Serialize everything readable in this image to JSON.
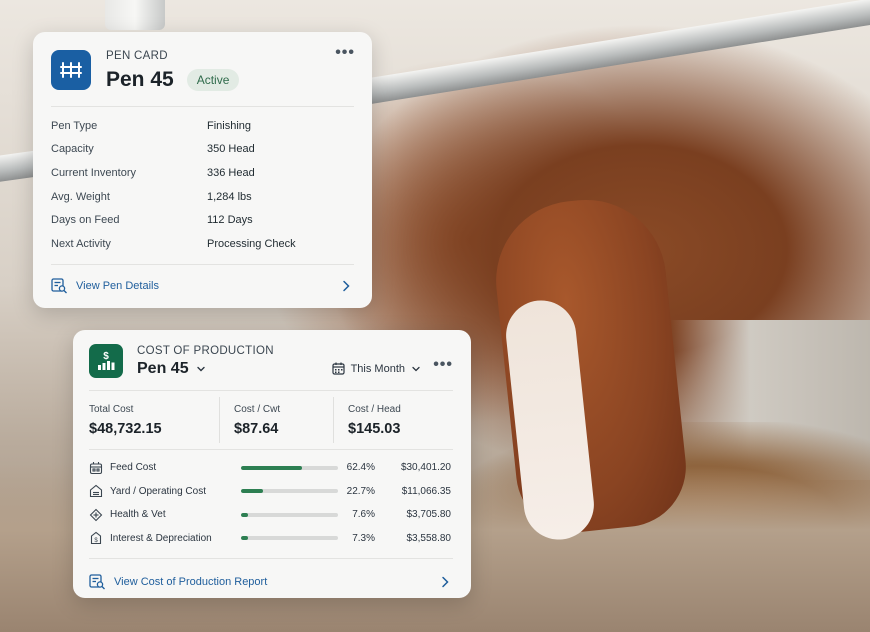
{
  "pen_card": {
    "eyebrow": "PEN CARD",
    "title": "Pen 45",
    "status": "Active",
    "rows": [
      {
        "label": "Pen Type",
        "value": "Finishing"
      },
      {
        "label": "Capacity",
        "value": "350 Head"
      },
      {
        "label": "Current Inventory",
        "value": "336 Head"
      },
      {
        "label": "Avg. Weight",
        "value": "1,284 lbs"
      },
      {
        "label": "Days on Feed",
        "value": "112 Days"
      },
      {
        "label": "Next Activity",
        "value": "Processing Check"
      }
    ],
    "link": "View Pen Details"
  },
  "cost_card": {
    "eyebrow": "COST OF PRODUCTION",
    "title": "Pen 45",
    "period": "This Month",
    "stats": [
      {
        "label": "Total Cost",
        "value": "$48,732.15"
      },
      {
        "label": "Cost / Cwt",
        "value": "$87.64"
      },
      {
        "label": "Cost / Head",
        "value": "$145.03"
      }
    ],
    "items": [
      {
        "label": "Feed Cost",
        "percent": "62.4%",
        "share": 62.4,
        "amount": "$30,401.20",
        "icon": "feed-icon"
      },
      {
        "label": "Yard / Operating Cost",
        "percent": "22.7%",
        "share": 22.7,
        "amount": "$11,066.35",
        "icon": "yard-icon"
      },
      {
        "label": "Health & Vet",
        "percent": "7.6%",
        "share": 7.6,
        "amount": "$3,705.80",
        "icon": "health-icon"
      },
      {
        "label": "Interest & Depreciation",
        "percent": "7.3%",
        "share": 7.3,
        "amount": "$3,558.80",
        "icon": "interest-icon"
      }
    ],
    "link": "View Cost of Production Report"
  },
  "colors": {
    "pen_logo": "#1a5fa3",
    "cost_logo": "#136b4a",
    "bar_fill": "#2d7f52",
    "link": "#1f5e9c",
    "badge_bg": "#e2ebe4"
  }
}
